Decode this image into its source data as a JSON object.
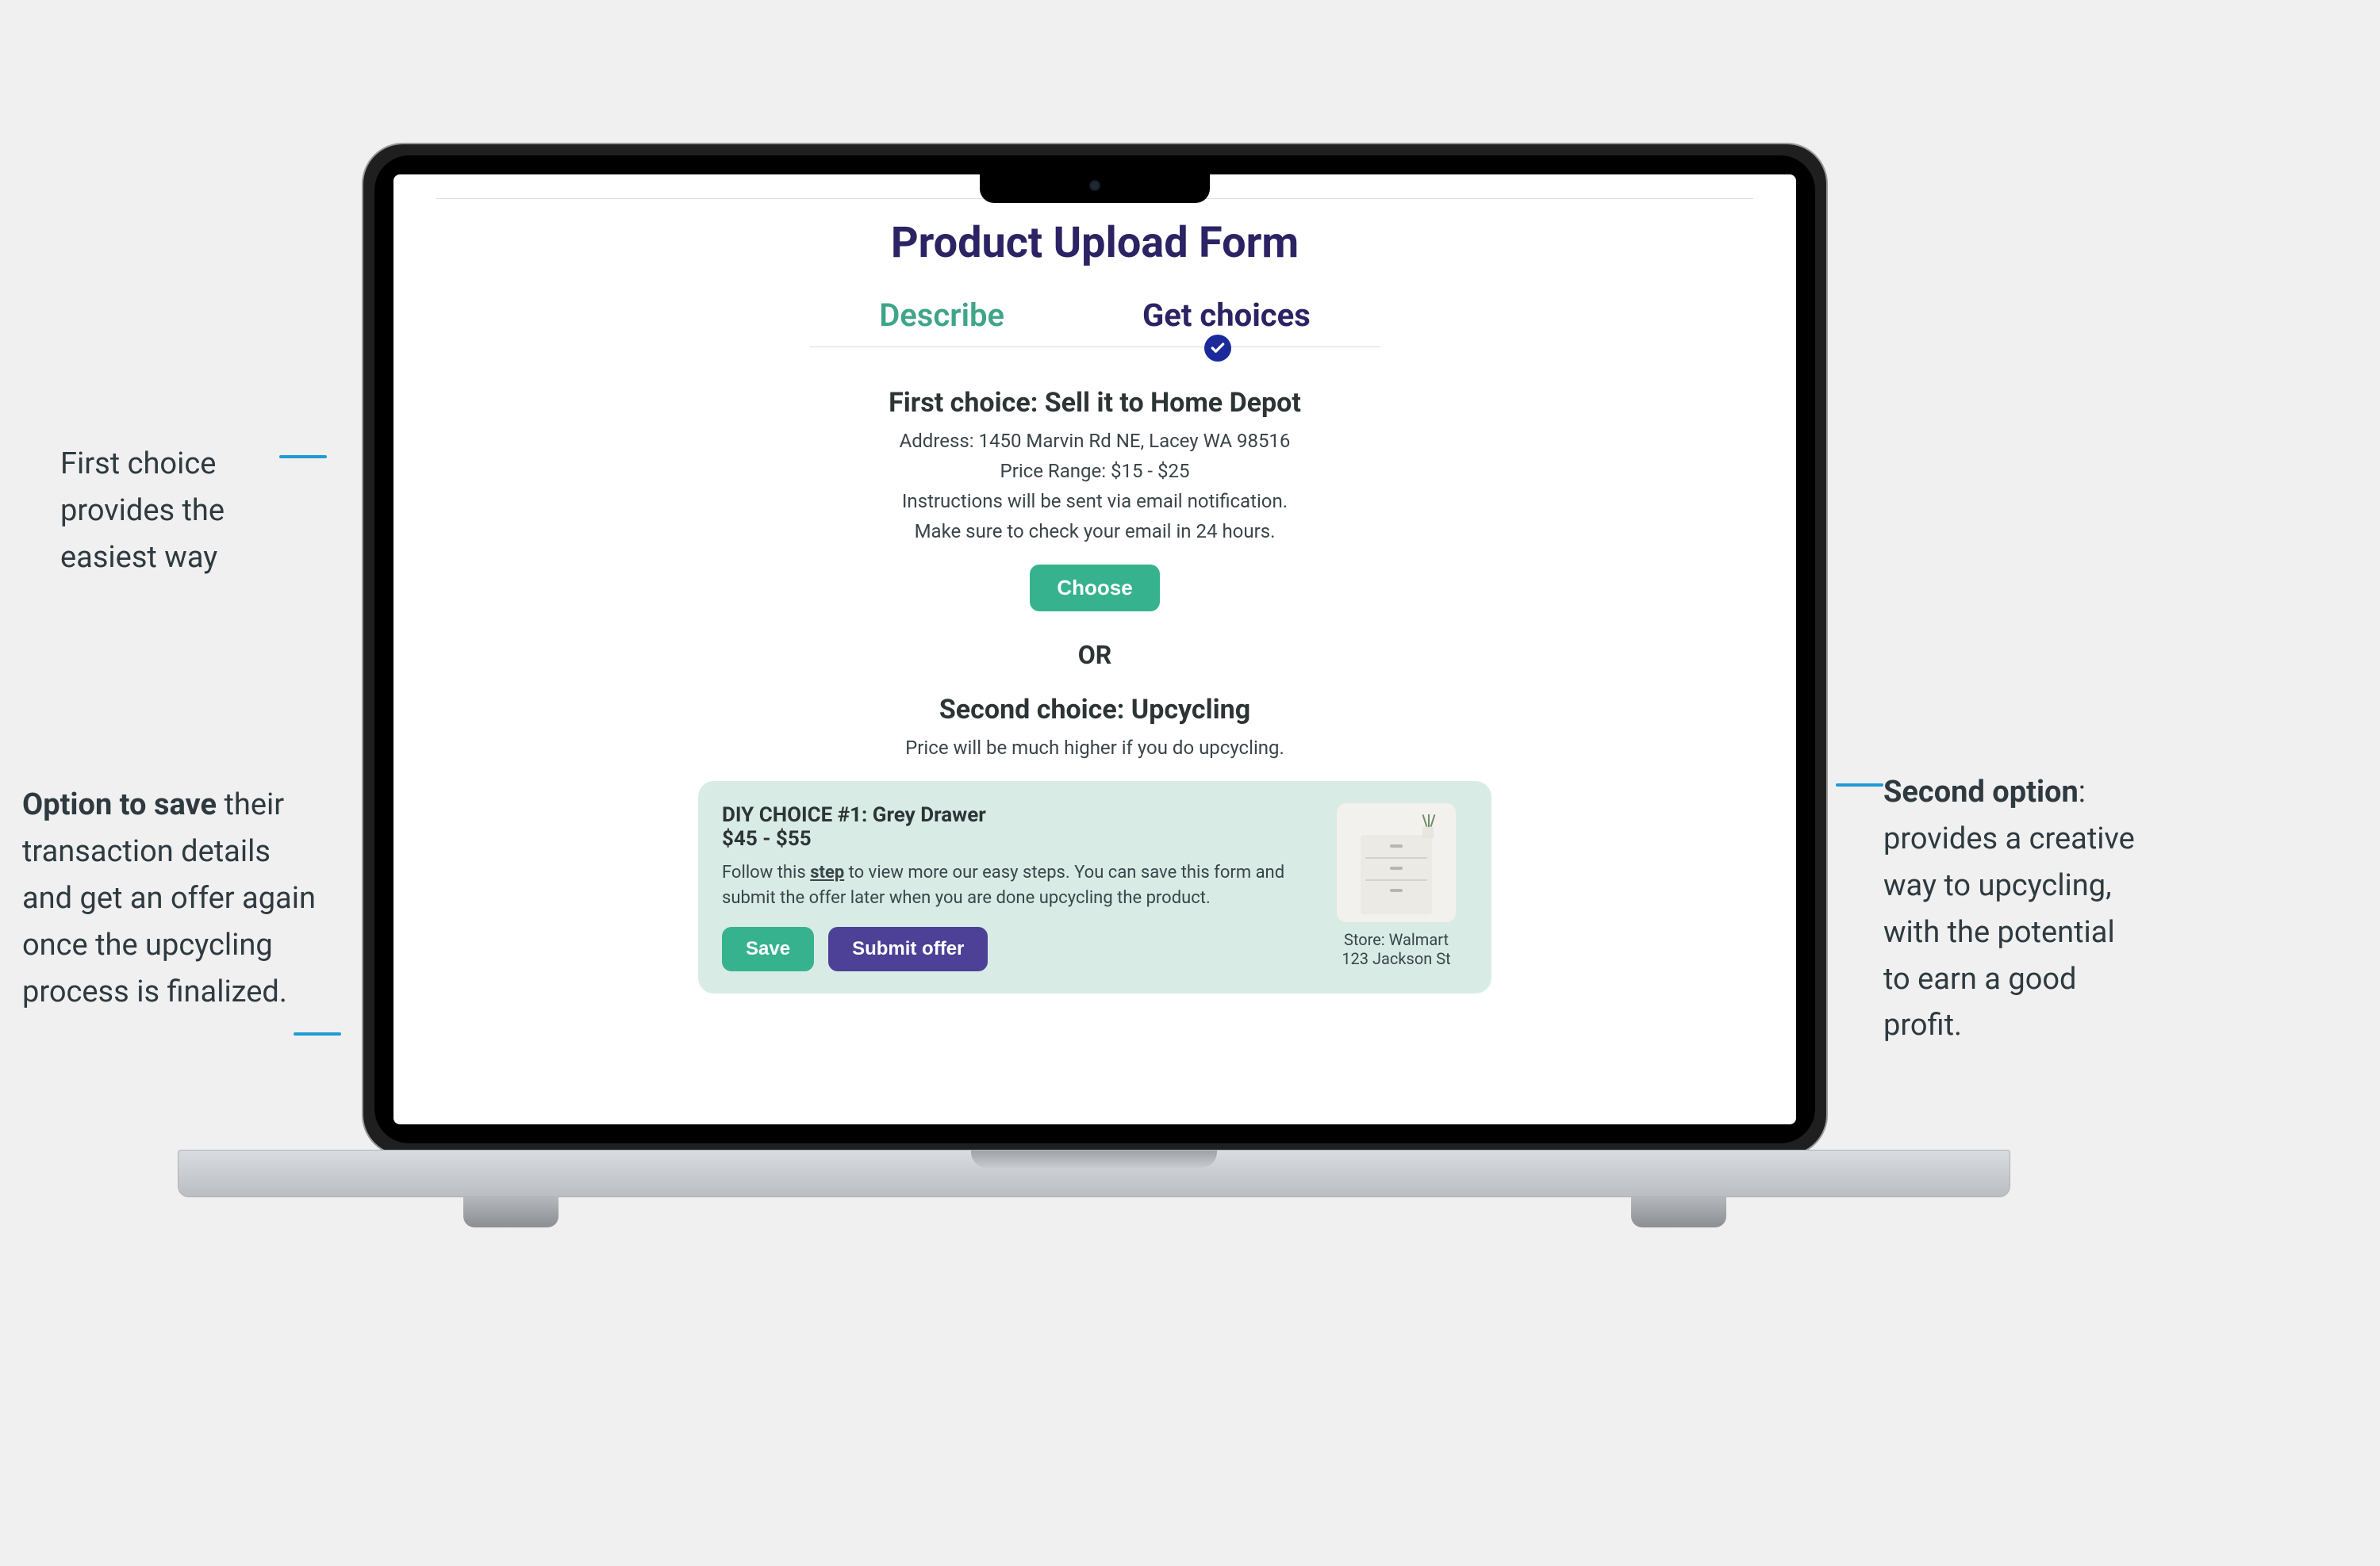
{
  "annotations": {
    "left1": "First choice provides the easiest way",
    "left2_bold": "Option to save",
    "left2_rest": " their transaction details and get an offer again once the upcycling process is finalized.",
    "right_bold": "Second option",
    "right_rest": ": provides a creative way to upcycling, with the potential to earn a good profit."
  },
  "page": {
    "title": "Product Upload Form",
    "tabs": {
      "describe": "Describe",
      "choices": "Get choices"
    },
    "first": {
      "title": "First choice: Sell it to Home Depot",
      "address": "Address: 1450 Marvin Rd NE, Lacey WA 98516",
      "price": "Price Range: $15 - $25",
      "instructions1": "Instructions will be sent via email notification.",
      "instructions2": "Make sure to check your email in 24 hours.",
      "choose": "Choose"
    },
    "or": "OR",
    "second": {
      "title": "Second choice: Upcycling",
      "subtitle": "Price will be much higher if you do upcycling."
    },
    "diy": {
      "heading": "DIY CHOICE #1: Grey Drawer",
      "price": "$45 - $55",
      "desc_pre": "Follow this ",
      "desc_link": "step",
      "desc_post": " to view more our easy steps. You can save this form and submit the offer later when you are done upcycling the product.",
      "save": "Save",
      "submit": "Submit offer",
      "store": "Store: Walmart",
      "store_addr": "123 Jackson St"
    }
  },
  "colors": {
    "accent_green": "#36b28e",
    "accent_purple": "#4c4196",
    "title_navy": "#2b2363",
    "callout_blue": "#209ad6"
  }
}
